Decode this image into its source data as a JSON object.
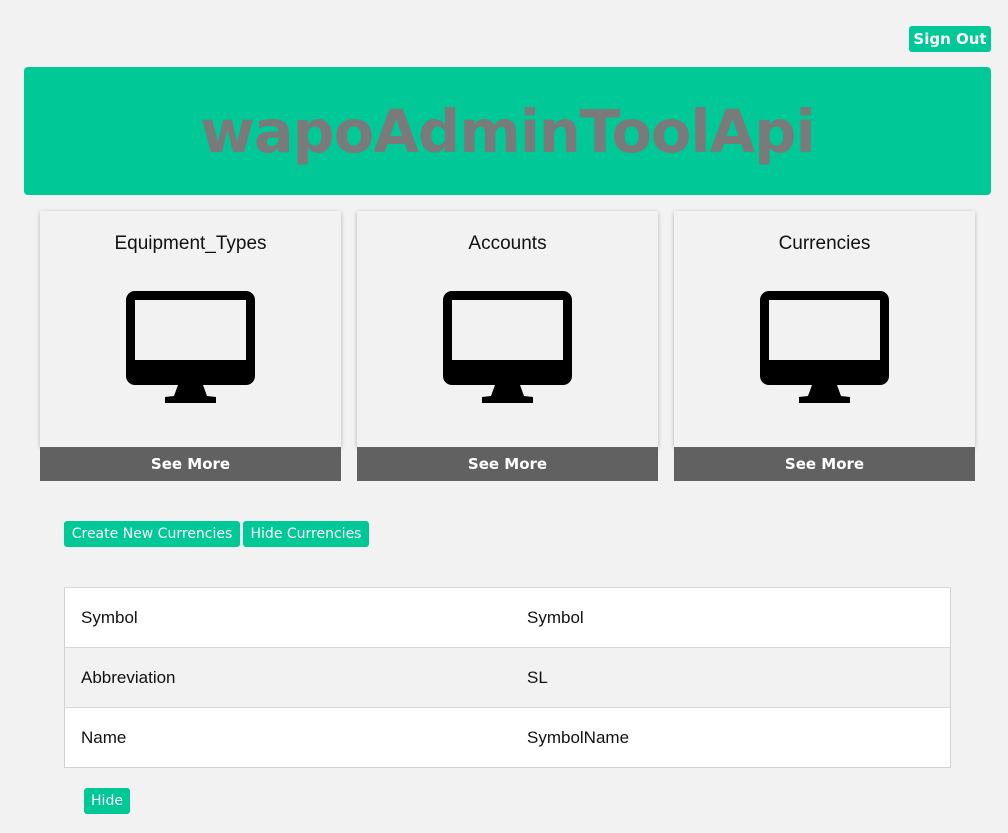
{
  "header": {
    "sign_out_label": "Sign Out"
  },
  "banner": {
    "title": "wapoAdminToolApi"
  },
  "cards": [
    {
      "title": "Equipment_Types",
      "icon": "monitor-icon",
      "more_label": "See More"
    },
    {
      "title": "Accounts",
      "icon": "monitor-icon",
      "more_label": "See More"
    },
    {
      "title": "Currencies",
      "icon": "monitor-icon",
      "more_label": "See More"
    }
  ],
  "actions": {
    "create_label": "Create New Currencies",
    "hide_currencies_label": "Hide Currencies"
  },
  "detail_table": {
    "rows": [
      {
        "key": "Symbol",
        "value": "Symbol"
      },
      {
        "key": "Abbreviation",
        "value": "SL"
      },
      {
        "key": "Name",
        "value": "SymbolName"
      }
    ]
  },
  "footer": {
    "hide_label": "Hide"
  },
  "colors": {
    "accent": "#00c896",
    "banner_text": "#7a7a7a",
    "card_footer": "#616161"
  }
}
